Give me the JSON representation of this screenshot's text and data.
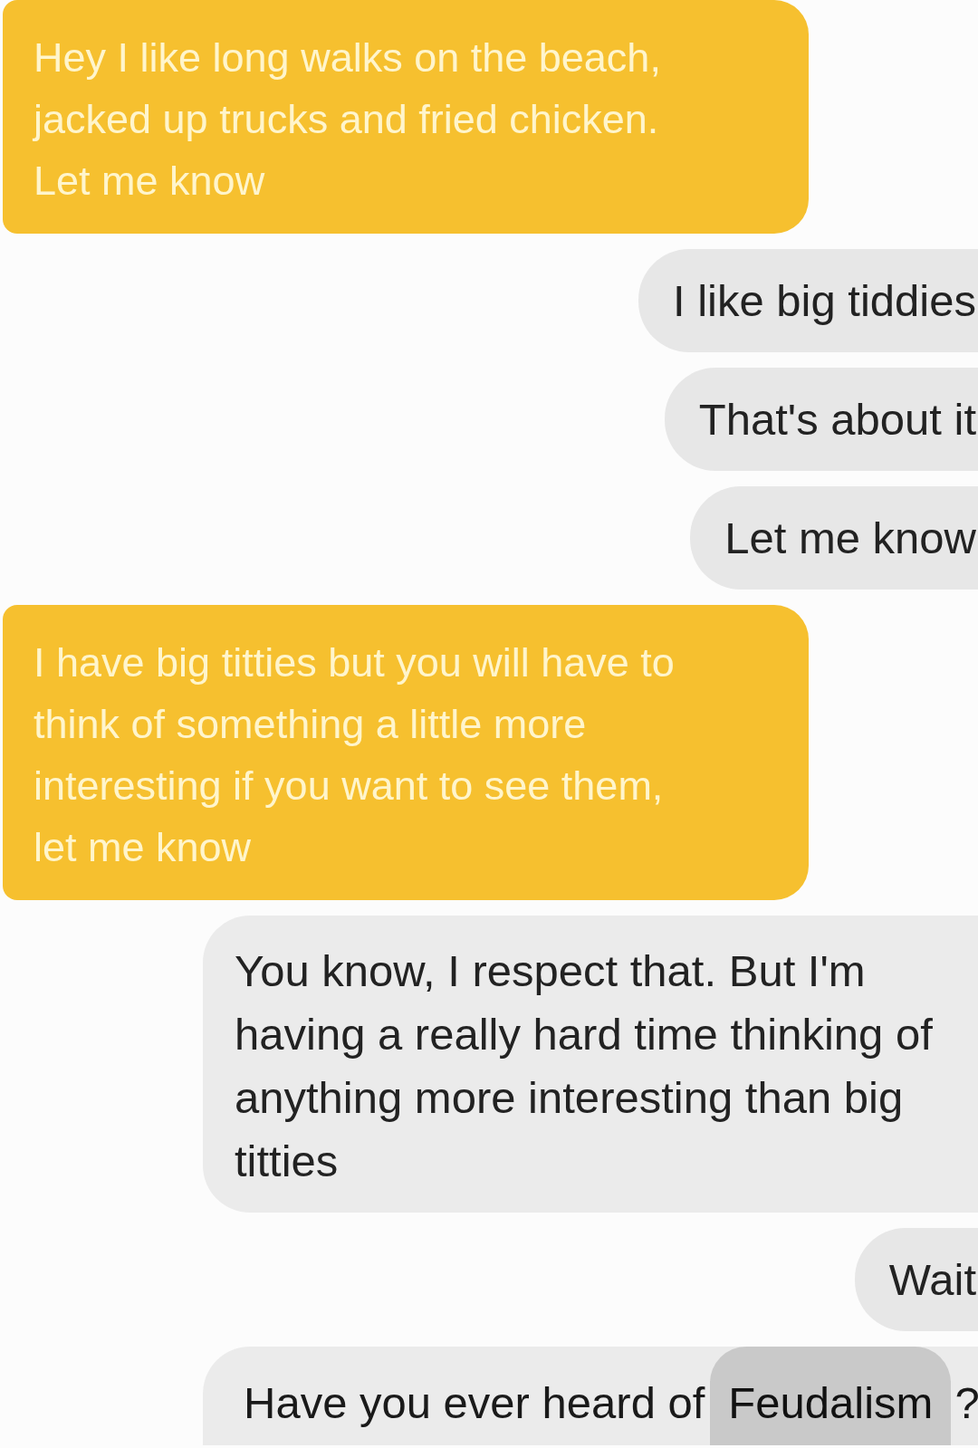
{
  "messages": [
    {
      "kind": "received",
      "lines": [
        "Hey I like long walks on the beach,",
        "jacked up trucks and fried chicken.",
        "Let me know"
      ]
    },
    {
      "kind": "sent",
      "lines": [
        "I like big tiddies"
      ]
    },
    {
      "kind": "sent",
      "lines": [
        "That's about it"
      ]
    },
    {
      "kind": "sent",
      "lines": [
        "Let me know"
      ]
    },
    {
      "kind": "received",
      "lines": [
        "I have big titties but you will have to",
        "think of something a little more",
        "interesting if you want to see them,",
        "let me know"
      ]
    },
    {
      "kind": "sent",
      "lines": [
        "You know, I respect that. But I'm",
        "having a really hard time thinking of",
        "anything more interesting than big",
        "titties"
      ]
    },
    {
      "kind": "sent",
      "lines": [
        "Wait"
      ]
    },
    {
      "kind": "sent_edited",
      "segments": [
        {
          "text": "Have you ever heard of",
          "highlighted": false
        },
        {
          "text": "Feudalism",
          "highlighted": true
        },
        {
          "text": "?",
          "highlighted": false
        }
      ]
    }
  ]
}
